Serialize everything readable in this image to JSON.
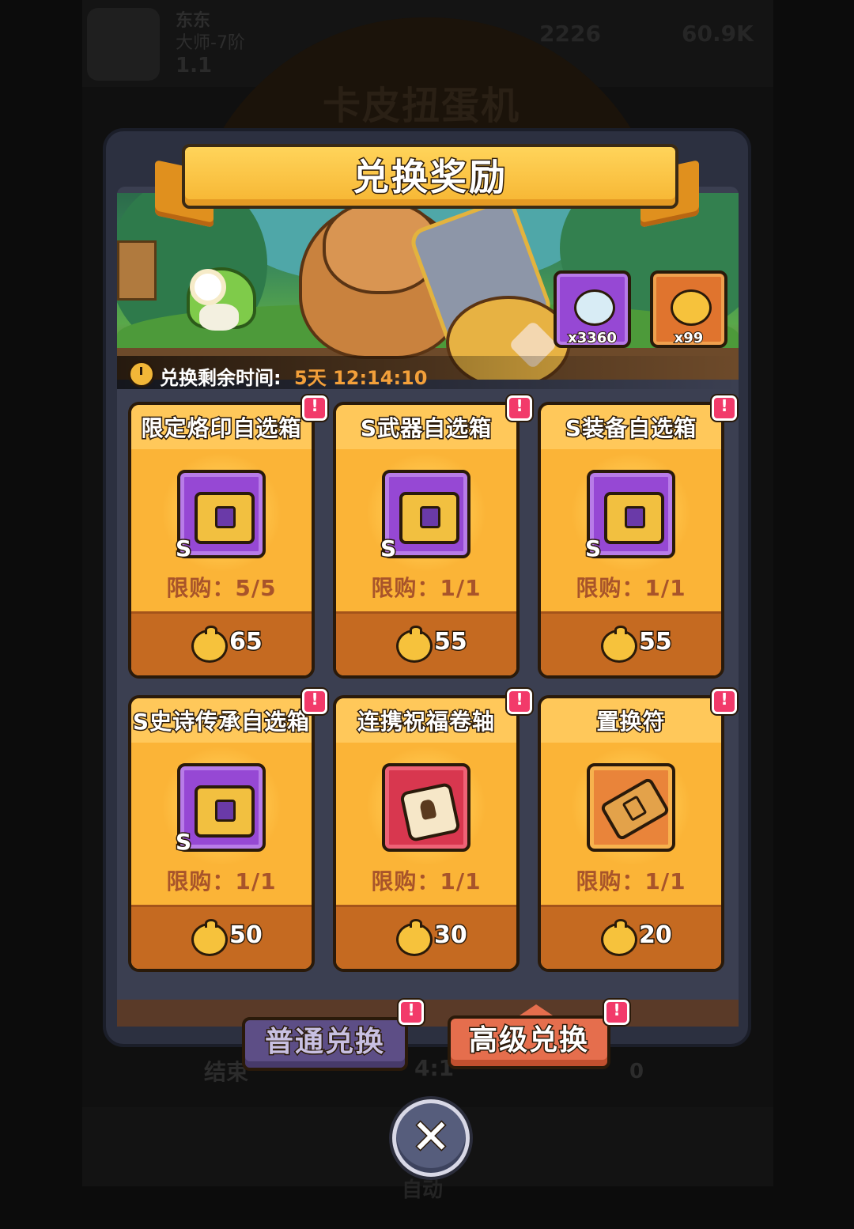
{
  "background": {
    "player_name": "东东",
    "player_rank": "大师-7阶",
    "player_stat": "1.1",
    "currency_a": "2226",
    "currency_b": "60.9K",
    "screen_title": "卡皮扭蛋机",
    "end_label": "结束",
    "end_time": "4:1",
    "counter": "0",
    "auto_label": "自动"
  },
  "modal": {
    "title": "兑换奖励",
    "resources": [
      {
        "icon": "dumpling-icon",
        "count": "x3360"
      },
      {
        "icon": "chick-coin-icon",
        "count": "x99"
      }
    ],
    "timer": {
      "label": "兑换剩余时间:",
      "value": "5天 12:14:10"
    },
    "items": [
      {
        "name": "限定烙印自选箱",
        "limit": "限购：5/5",
        "price": "65",
        "grade": "S",
        "icon": "brand-chest-icon",
        "frame": "purple"
      },
      {
        "name": "S武器自选箱",
        "limit": "限购：1/1",
        "price": "55",
        "grade": "S",
        "icon": "weapon-chest-icon",
        "frame": "purple"
      },
      {
        "name": "S装备自选箱",
        "limit": "限购：1/1",
        "price": "55",
        "grade": "S",
        "icon": "equipment-chest-icon",
        "frame": "purple"
      },
      {
        "name": "S史诗传承自选箱",
        "limit": "限购：1/1",
        "price": "50",
        "grade": "S",
        "icon": "epic-chest-icon",
        "frame": "purple"
      },
      {
        "name": "连携祝福卷轴",
        "limit": "限购：1/1",
        "price": "30",
        "grade": "",
        "icon": "scroll-icon",
        "frame": "red"
      },
      {
        "name": "置换符",
        "limit": "限购：1/1",
        "price": "20",
        "grade": "",
        "icon": "ticket-icon",
        "frame": "orange"
      }
    ],
    "tabs": {
      "normal": "普通兑换",
      "advanced": "高级兑换"
    },
    "close_icon": "close-icon",
    "colors": {
      "card": "#fbb437",
      "price_bar": "#c56a21",
      "alert": "#f23a6a",
      "timer_value": "#f3a03a"
    }
  }
}
